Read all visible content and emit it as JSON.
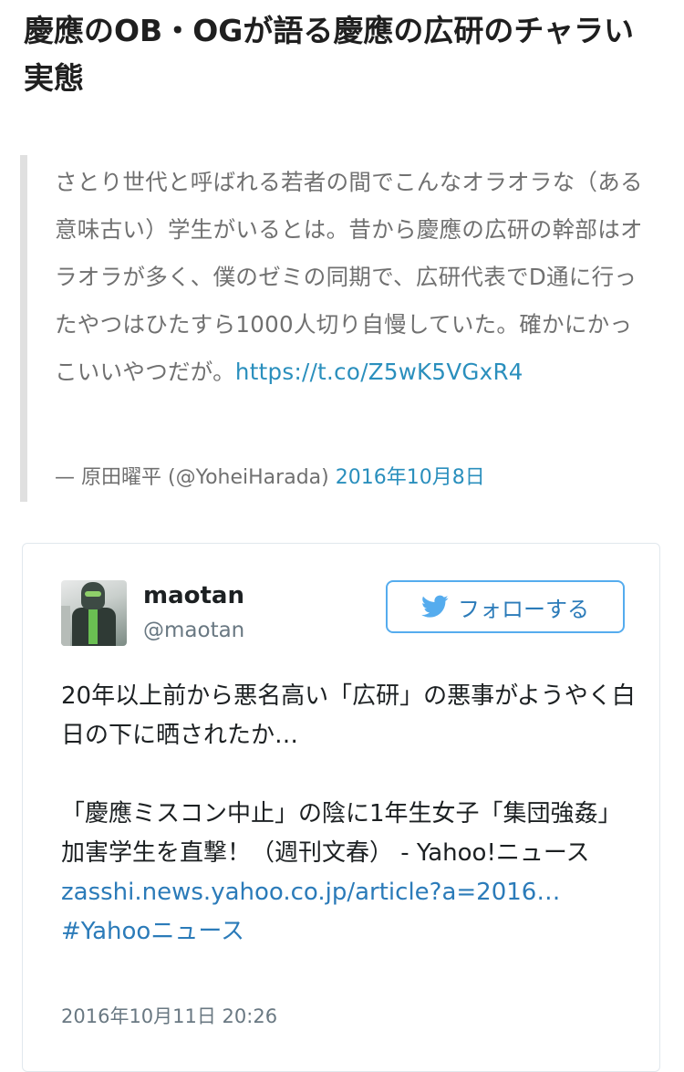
{
  "article": {
    "title": "慶應のOB・OGが語る慶應の広研のチャラい実態"
  },
  "quote": {
    "text": "さとり世代と呼ばれる若者の間でこんなオラオラな（ある意味古い）学生がいるとは。昔から慶應の広研の幹部はオラオラが多く、僕のゼミの同期で、広研代表でD通に行ったやつはひたすら1000人切り自慢していた。確かにかっこいいやつだが。",
    "link": "https://t.co/Z5wK5VGxR4",
    "source_prefix": "— 原田曜平 (@YoheiHarada)",
    "date": "2016年10月8日"
  },
  "tweet": {
    "name": "maotan",
    "handle": "@maotan",
    "follow_label": "フォローする",
    "line1": "20年以上前から悪名高い「広研」の悪事がようやく白日の下に晒されたか…",
    "line2": "「慶應ミスコン中止」の陰に1年生女子「集団強姦」　加害学生を直撃！（週刊文春） - Yahoo!ニュース",
    "link": "zasshi.news.yahoo.co.jp/article?a=2016…",
    "hashtag": "#Yahooニュース",
    "timestamp": "2016年10月11日 20:26"
  },
  "colors": {
    "link": "#2b7bb9",
    "quote_link": "#2a8fbd",
    "follow_border": "#55acee",
    "quote_bar": "#e0e0e0"
  },
  "icons": {
    "follow_button": "twitter-bird-icon"
  }
}
